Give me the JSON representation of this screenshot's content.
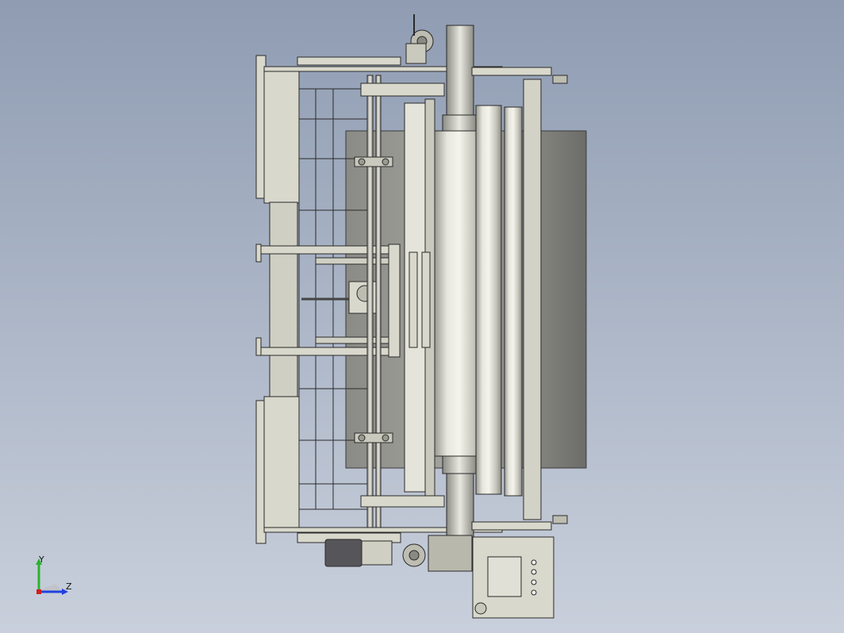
{
  "viewport": {
    "background_top": "#8f9cb2",
    "background_bottom": "#c9d0dc",
    "part_fill": "#d8d8cc",
    "part_fill_dark": "#b9b9ad",
    "edge_color": "#2a2a2a",
    "shadow_fill": "#7a7a78"
  },
  "triad": {
    "y_label": "Y",
    "z_label": "Z",
    "y_color": "#2bb32b",
    "z_color": "#2040e0",
    "x_color": "#d02020"
  }
}
